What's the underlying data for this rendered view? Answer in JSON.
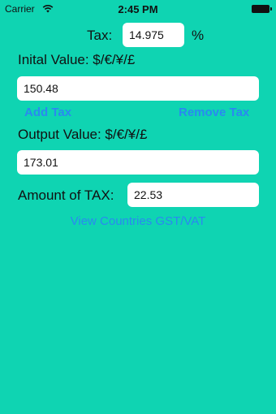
{
  "status_bar": {
    "carrier": "Carrier",
    "time": "2:45 PM",
    "wifi_icon": "wifi-icon",
    "battery_icon": "battery-icon"
  },
  "tax": {
    "label": "Tax:",
    "value": "14.975",
    "unit": "%"
  },
  "initial": {
    "label": "Inital Value: $/€/¥/£",
    "value": "150.48"
  },
  "actions": {
    "add_tax": "Add Tax",
    "remove_tax": "Remove Tax"
  },
  "output": {
    "label": "Output Value: $/€/¥/£",
    "value": "173.01"
  },
  "amount": {
    "label": "Amount of TAX:",
    "value": "22.53"
  },
  "countries_link": "View Countries GST/VAT",
  "colors": {
    "background": "#0fd4b2",
    "link": "#2a89f0",
    "field": "#ffffff"
  }
}
